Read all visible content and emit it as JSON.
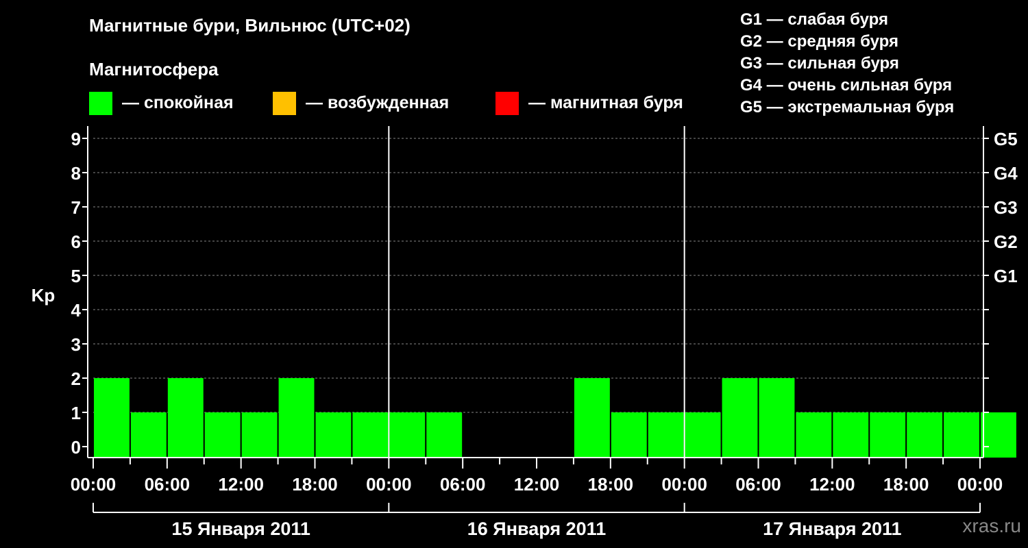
{
  "header": {
    "title": "Магнитные бури, Вильнюс (UTC+02)",
    "subtitle": "Магнитосфера",
    "legend": [
      {
        "label": "— спокойная",
        "color": "#00ff00"
      },
      {
        "label": "— возбужденная",
        "color": "#ffc000"
      },
      {
        "label": "— магнитная буря",
        "color": "#ff0000"
      }
    ],
    "g_scale": [
      "G1 — слабая буря",
      "G2 — средняя буря",
      "G3 — сильная буря",
      "G4 — очень сильная буря",
      "G5 — экстремальная буря"
    ]
  },
  "watermark": "xras.ru",
  "chart_data": {
    "type": "bar",
    "ylabel": "Kp",
    "ylim": [
      0,
      9
    ],
    "y_ticks": [
      "0",
      "1",
      "2",
      "3",
      "4",
      "5",
      "6",
      "7",
      "8",
      "9"
    ],
    "y2_ticks": [
      {
        "value": 5,
        "label": "G1"
      },
      {
        "value": 6,
        "label": "G2"
      },
      {
        "value": 7,
        "label": "G3"
      },
      {
        "value": 8,
        "label": "G4"
      },
      {
        "value": 9,
        "label": "G5"
      }
    ],
    "x_tick_labels": [
      "00:00",
      "06:00",
      "12:00",
      "18:00",
      "00:00",
      "06:00",
      "12:00",
      "18:00",
      "00:00",
      "06:00",
      "12:00",
      "18:00",
      "00:00",
      "06:00",
      "12:00",
      "18:00",
      "00:00"
    ],
    "days": [
      "15 Января 2011",
      "16 Января 2011",
      "17 Января 2011"
    ],
    "grid": true,
    "bar_color": "#00ff00",
    "values": [
      2,
      1,
      2,
      1,
      1,
      2,
      1,
      1,
      1,
      1,
      0,
      0,
      0,
      2,
      1,
      1,
      1,
      2,
      2,
      1,
      1,
      1,
      1,
      1,
      1
    ]
  }
}
